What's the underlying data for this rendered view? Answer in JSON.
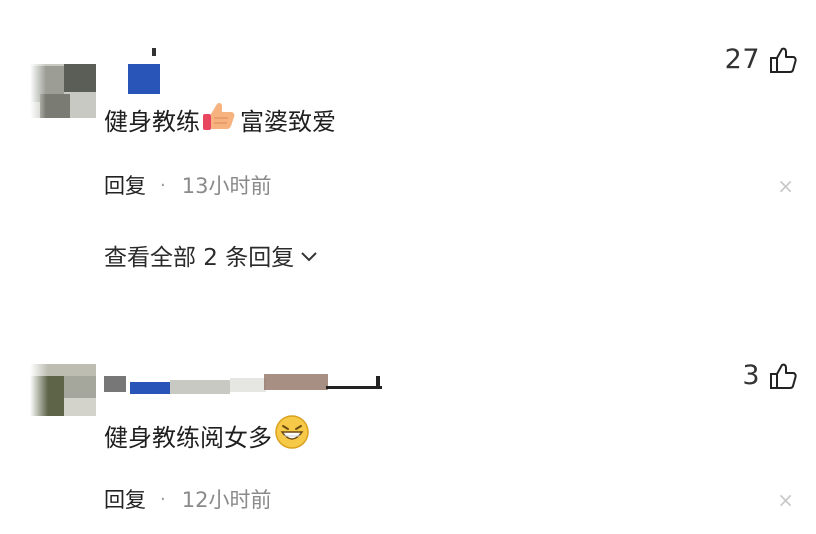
{
  "comments": [
    {
      "likes": "27",
      "text": "健身教练",
      "emoji": "thumbs-up-emoji",
      "text_after": "富婆致爱",
      "reply_label": "回复",
      "separator": "·",
      "time": "13小时前",
      "more_replies": "查看全部 2 条回复",
      "close": "×"
    },
    {
      "likes": "3",
      "text": "健身教练阅女多",
      "emoji": "grinning-face-emoji",
      "reply_label": "回复",
      "separator": "·",
      "time": "12小时前",
      "close": "×"
    }
  ],
  "icons": {
    "like": "thumbs-up-outline-icon",
    "expand": "chevron-down-icon",
    "dismiss": "close-icon"
  },
  "colors": {
    "meta_time": "#8a8a8a",
    "close": "#c8c8c8",
    "accent_blue": "#2a55b8"
  }
}
